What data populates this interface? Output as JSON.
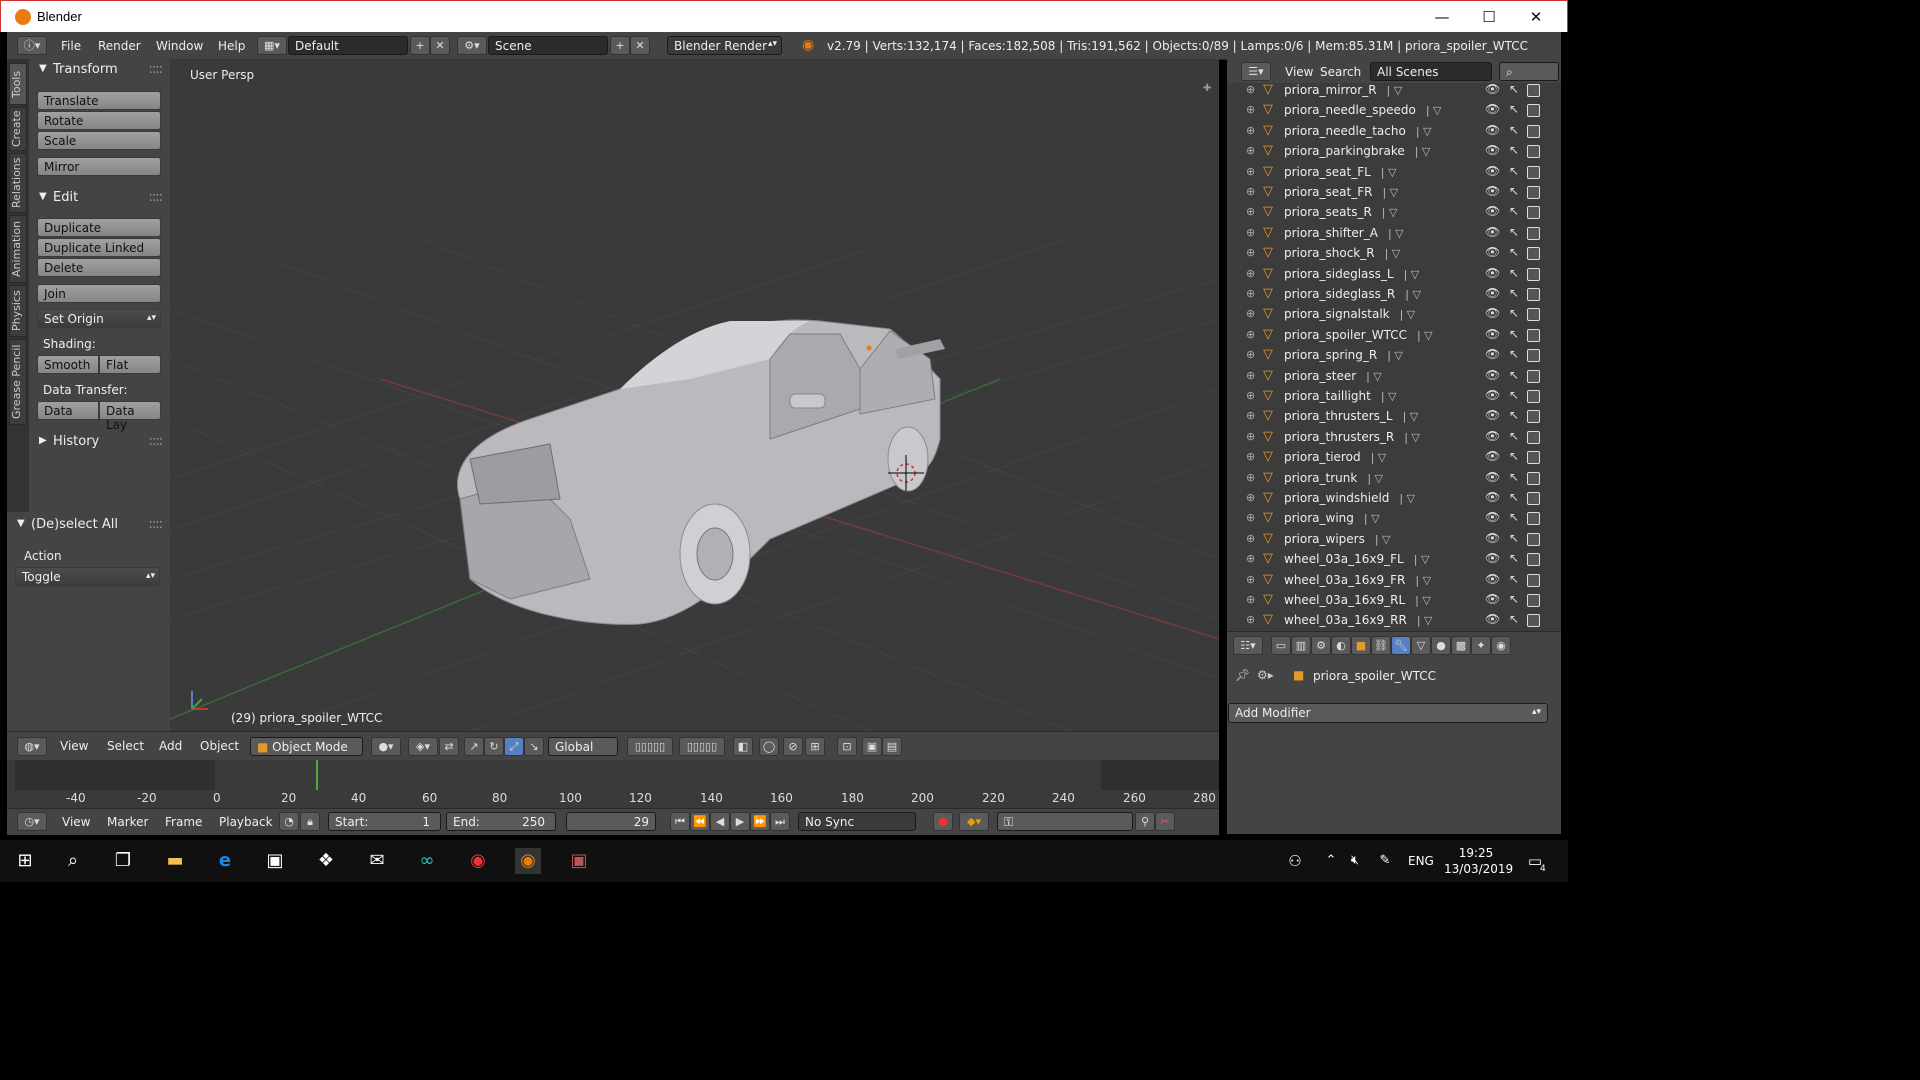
{
  "window": {
    "title": "Blender",
    "minimize": "—",
    "maximize": "☐",
    "close": "✕"
  },
  "info_header": {
    "menus": [
      "File",
      "Render",
      "Window",
      "Help"
    ],
    "layout": "Default",
    "scene": "Scene",
    "engine": "Blender Render",
    "stats": "v2.79 | Verts:132,174 | Faces:182,508 | Tris:191,562 | Objects:0/89 | Lamps:0/6 | Mem:85.31M | priora_spoiler_WTCC"
  },
  "tool_tabs": [
    "Tools",
    "Create",
    "Relations",
    "Animation",
    "Physics",
    "Grease Pencil"
  ],
  "tool_shelf": {
    "transform": {
      "title": "Transform",
      "buttons": [
        "Translate",
        "Rotate",
        "Scale",
        "Mirror"
      ]
    },
    "edit": {
      "title": "Edit",
      "buttons": [
        "Duplicate",
        "Duplicate Linked",
        "Delete",
        "Join",
        "Set Origin"
      ]
    },
    "shading_label": "Shading:",
    "shading": [
      "Smooth",
      "Flat"
    ],
    "data_transfer_label": "Data Transfer:",
    "data_transfer": [
      "Data",
      "Data Lay"
    ],
    "history": "History",
    "operator": {
      "title": "(De)select All",
      "action_label": "Action",
      "action_value": "Toggle"
    }
  },
  "viewport": {
    "view_label": "User Persp",
    "object_label": "(29) priora_spoiler_WTCC"
  },
  "viewport_header": {
    "menus": [
      "View",
      "Select",
      "Add",
      "Object"
    ],
    "mode": "Object Mode",
    "orientation": "Global"
  },
  "timeline": {
    "ticks": [
      "-40",
      "-20",
      "0",
      "20",
      "40",
      "60",
      "80",
      "100",
      "120",
      "140",
      "160",
      "180",
      "200",
      "220",
      "240",
      "260",
      "280"
    ],
    "menus": [
      "View",
      "Marker",
      "Frame",
      "Playback"
    ],
    "start_label": "Start:",
    "start": "1",
    "end_label": "End:",
    "end": "250",
    "current": "29",
    "sync": "No Sync"
  },
  "outliner": {
    "menus": [
      "View",
      "Search"
    ],
    "scope": "All Scenes",
    "items": [
      "priora_mirror_R",
      "priora_needle_speedo",
      "priora_needle_tacho",
      "priora_parkingbrake",
      "priora_seat_FL",
      "priora_seat_FR",
      "priora_seats_R",
      "priora_shifter_A",
      "priora_shock_R",
      "priora_sideglass_L",
      "priora_sideglass_R",
      "priora_signalstalk",
      "priora_spoiler_WTCC",
      "priora_spring_R",
      "priora_steer",
      "priora_taillight",
      "priora_thrusters_L",
      "priora_thrusters_R",
      "priora_tierod",
      "priora_trunk",
      "priora_windshield",
      "priora_wing",
      "priora_wipers",
      "wheel_03a_16x9_FL",
      "wheel_03a_16x9_FR",
      "wheel_03a_16x9_RL",
      "wheel_03a_16x9_RR"
    ]
  },
  "properties": {
    "object": "priora_spoiler_WTCC",
    "add_modifier": "Add Modifier"
  },
  "taskbar": {
    "lang": "ENG",
    "time": "19:25",
    "date": "13/03/2019",
    "notifications": "4"
  },
  "colors": {
    "accent": "#e87d0d",
    "ui_bg": "#444444",
    "viewport_bg": "#3a3a3a",
    "selected_blue": "#5680c2"
  }
}
